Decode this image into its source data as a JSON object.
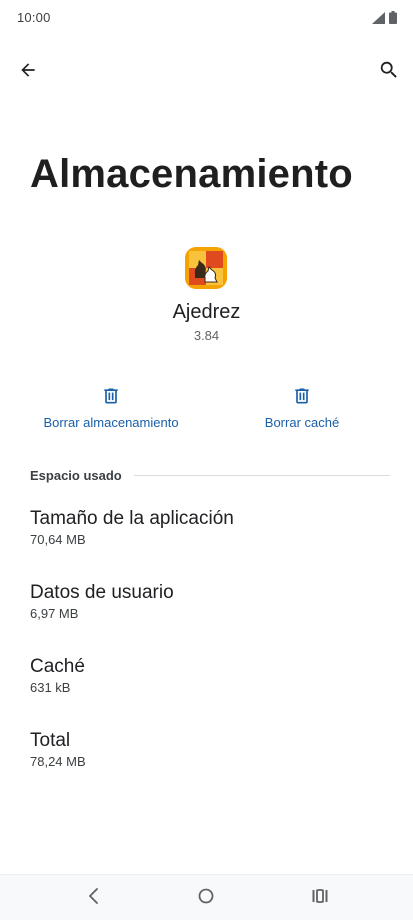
{
  "status_bar": {
    "time": "10:00",
    "icons": [
      "signal-icon",
      "battery-icon"
    ]
  },
  "app_bar": {
    "back_icon": "arrow-back-icon",
    "search_icon": "search-icon"
  },
  "page": {
    "title": "Almacenamiento"
  },
  "app": {
    "name": "Ajedrez",
    "version": "3.84",
    "icon": "chess-app-icon"
  },
  "actions": {
    "clear_storage_label": "Borrar almacenamiento",
    "clear_cache_label": "Borrar caché",
    "icon": "trash-icon"
  },
  "section": {
    "title": "Espacio usado"
  },
  "storage_items": [
    {
      "title": "Tamaño de la aplicación",
      "value": "70,64 MB"
    },
    {
      "title": "Datos de usuario",
      "value": "6,97 MB"
    },
    {
      "title": "Caché",
      "value": "631 kB"
    },
    {
      "title": "Total",
      "value": "78,24 MB"
    }
  ],
  "nav_bar": {
    "icons": [
      "nav-back-icon",
      "nav-home-icon",
      "nav-recents-icon"
    ]
  },
  "colors": {
    "accent": "#1a5fa8",
    "title": "#1f1f1f",
    "secondary_text": "#5f6368"
  }
}
